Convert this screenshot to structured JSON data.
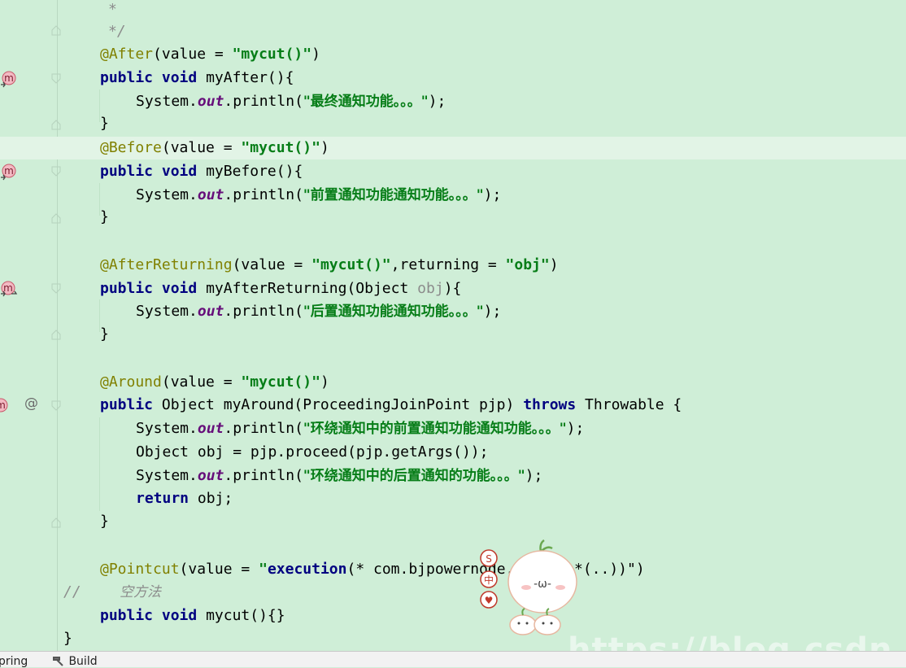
{
  "editor": {
    "lines": {
      "c1": "*",
      "c2": "*/",
      "after_anno": "@After",
      "after_args_pre": "(value = ",
      "after_str": "\"mycut()\"",
      "after_args_post": ")",
      "kw_public": "public",
      "kw_void": "void",
      "kw_throws": "throws",
      "kw_return": "return",
      "myafter_sig": " myAfter(){",
      "sysout_pre": "System.",
      "sysout_field": "out",
      "sysout_mid": ".println(",
      "after_msg": "\"最终通知功能。。。\"",
      "sysout_end": ");",
      "close_brace": "}",
      "before_anno": "@Before",
      "before_args_pre": "(value = ",
      "before_str": "\"mycut()\"",
      "before_args_post": ")",
      "mybefore_sig": " myBefore(){",
      "before_msg": "\"前置通知功能通知功能。。。\"",
      "afterreturning_anno": "@AfterReturning",
      "ar_args_pre": "(value = ",
      "ar_str1": "\"mycut()\"",
      "ar_args_mid": ",returning = ",
      "ar_str2": "\"obj\"",
      "ar_args_post": ")",
      "myar_sig_pre": " myAfterReturning(Object ",
      "myar_param": "obj",
      "myar_sig_post": "){",
      "ar_msg": "\"后置通知功能通知功能。。。\"",
      "around_anno": "@Around",
      "around_args_pre": "(value = ",
      "around_str": "\"mycut()\"",
      "around_args_post": ")",
      "myaround_sig": " Object myAround(ProceedingJoinPoint pjp) ",
      "myaround_throws_post": " Throwable {",
      "around_msg1": "\"环绕通知中的前置通知功能通知功能。。。\"",
      "proceed_line": "Object obj = pjp.proceed(pjp.getArgs());",
      "around_msg2": "\"环绕通知中的后置通知的功能。。。\"",
      "return_post": " obj;",
      "pointcut_anno": "@Pointcut",
      "pointcut_args_pre": "(value = ",
      "pointcut_str_a": "\"",
      "pointcut_execution": "execution",
      "pointcut_str_b": "(* com.bjpowernode.",
      "pointcut_str_c": "*(..))\"",
      "pointcut_args_post": ")",
      "comment_slashes": "//",
      "comment_text": "空方法",
      "mycut_sig": " mycut(){}",
      "class_close": "}"
    },
    "gutter": {
      "method_icon_letter": "m",
      "at_icon": "@"
    }
  },
  "statusbar": {
    "spring_label": "pring",
    "build_label": "Build"
  },
  "watermark": "https://blog.csdn.net",
  "mascot": {
    "face": "-ω-",
    "badges": [
      "S",
      "中",
      "♥"
    ]
  },
  "colors": {
    "background": "#cfeed7",
    "annotation": "#808000",
    "keyword": "#000080",
    "string": "#067d17",
    "field": "#660e7a",
    "comment": "#8c8c8c"
  }
}
